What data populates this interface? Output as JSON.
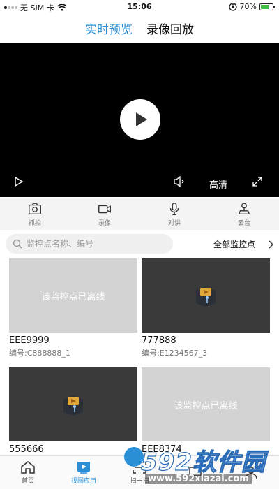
{
  "status_bar": {
    "carrier": "无 SIM 卡",
    "time": "15:06",
    "battery": "70%",
    "battery_level": 0.7
  },
  "tabs": [
    {
      "label": "实时预览",
      "active": true
    },
    {
      "label": "录像回放",
      "active": false
    }
  ],
  "video": {
    "quality": "高清"
  },
  "toolbar": [
    {
      "label": "抓拍",
      "icon": "camera-icon"
    },
    {
      "label": "录像",
      "icon": "video-record-icon"
    },
    {
      "label": "对讲",
      "icon": "microphone-icon"
    },
    {
      "label": "云台",
      "icon": "ptz-icon"
    }
  ],
  "search": {
    "placeholder": "监控点名称、编号",
    "filter_label": "全部监控点"
  },
  "cameras": [
    {
      "name": "EEE9999",
      "id": "编号:C888888_1",
      "status": "offline",
      "offline_text": "该监控点已离线"
    },
    {
      "name": "777888",
      "id": "编号:E1234567_3",
      "status": "online"
    },
    {
      "name": "555666",
      "id": "",
      "status": "online"
    },
    {
      "name": "EEE8374",
      "id": "",
      "status": "offline",
      "offline_text": "该监控点已离线"
    }
  ],
  "bottom_nav": [
    {
      "label": "首页",
      "icon": "home-icon",
      "active": false
    },
    {
      "label": "视图应用",
      "icon": "view-app-icon",
      "active": true
    },
    {
      "label": "扫一扫",
      "icon": "scan-icon",
      "active": false
    },
    {
      "label": "",
      "icon": "message-icon",
      "active": false
    },
    {
      "label": "",
      "icon": "user-icon",
      "active": false
    }
  ],
  "watermark": {
    "brand": "592软件园",
    "url": "www.592xiazai.com"
  },
  "colors": {
    "accent": "#2b8fd6",
    "video_bg": "#000000",
    "offline_thumb": "#d3d3d3",
    "online_thumb": "#3a3a3a"
  }
}
